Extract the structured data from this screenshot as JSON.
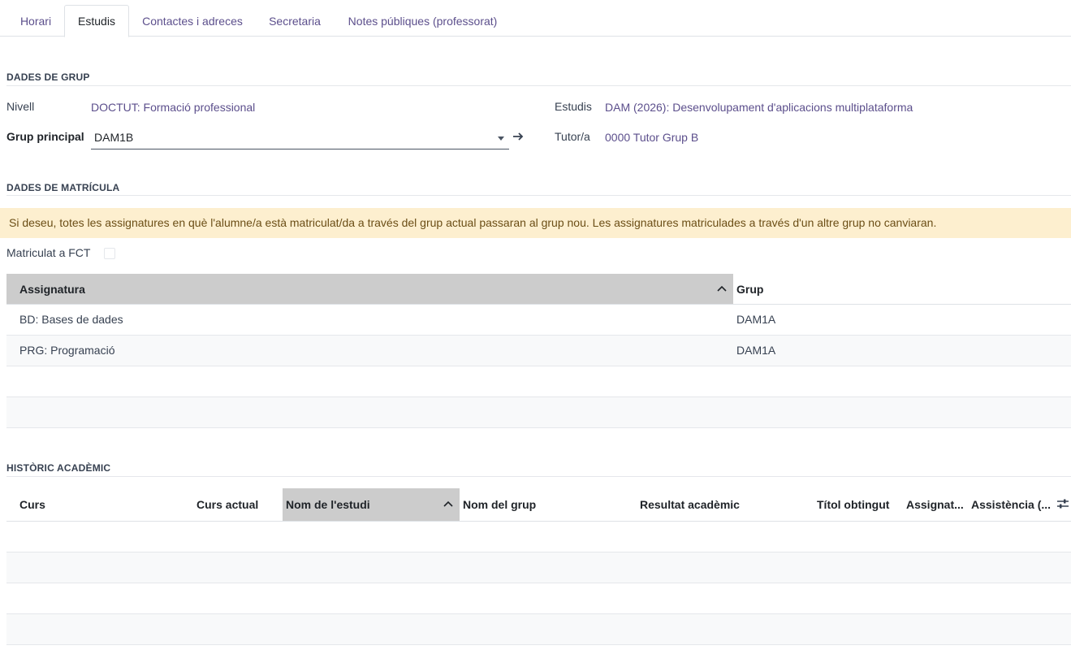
{
  "tabs": [
    {
      "label": "Horari",
      "active": false
    },
    {
      "label": "Estudis",
      "active": true
    },
    {
      "label": "Contactes i adreces",
      "active": false
    },
    {
      "label": "Secretaria",
      "active": false
    },
    {
      "label": "Notes públiques (professorat)",
      "active": false
    }
  ],
  "group_section": {
    "title": "DADES DE GRUP",
    "level_label": "Nivell",
    "level_value": "DOCTUT: Formació professional",
    "studies_label": "Estudis",
    "studies_value": "DAM (2026): Desenvolupament d'aplicacions multiplataforma",
    "main_group_label": "Grup principal",
    "main_group_value": "DAM1B",
    "tutor_label": "Tutor/a",
    "tutor_value": "0000 Tutor Grup B",
    "arrow_icon": "arrow-right-icon"
  },
  "enrollment_section": {
    "title": "DADES DE MATRÍCULA",
    "alert": "Si deseu, totes les assignatures en què l'alumne/a està matriculat/da a través del grup actual passaran al grup nou. Les assignatures matriculades a través d'un altre grup no canviaran.",
    "fct_label": "Matriculat a FCT",
    "fct_checked": false,
    "table": {
      "headers": [
        "Assignatura",
        "Grup"
      ],
      "rows": [
        [
          "BD: Bases de dades",
          "DAM1A"
        ],
        [
          "PRG: Programació",
          "DAM1A"
        ]
      ]
    }
  },
  "history_section": {
    "title": "HISTÒRIC ACADÈMIC",
    "headers": [
      "Curs",
      "Curs actual",
      "Nom de l'estudi",
      "Nom del grup",
      "Resultat acadèmic",
      "Títol obtingut",
      "Assignat...",
      "Assistència (..."
    ]
  },
  "colors": {
    "accent": "#5c4f8c",
    "alert_bg": "#fdefcf",
    "sorted_header": "#cccccc"
  }
}
